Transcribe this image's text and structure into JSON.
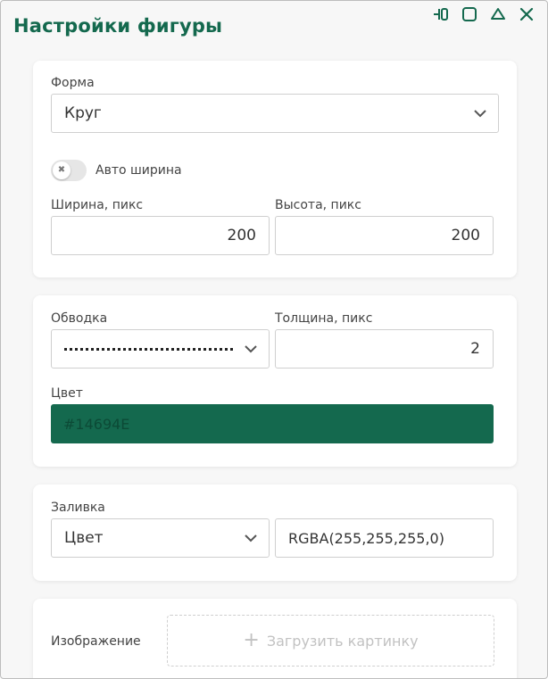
{
  "window": {
    "title": "Настройки фигуры"
  },
  "shape": {
    "label": "Форма",
    "value": "Круг",
    "auto_width_label": "Авто ширина",
    "auto_width_on": false,
    "width_label": "Ширина, пикс",
    "width_value": "200",
    "height_label": "Высота, пикс",
    "height_value": "200"
  },
  "stroke": {
    "label": "Обводка",
    "thickness_label": "Толщина, пикс",
    "thickness_value": "2",
    "color_label": "Цвет",
    "color_value": "#14694E"
  },
  "fill": {
    "label": "Заливка",
    "type_value": "Цвет",
    "color_value": "RGBA(255,255,255,0)"
  },
  "image": {
    "label": "Изображение",
    "upload_label": "Загрузить картинку"
  },
  "colors": {
    "accent": "#14694E"
  },
  "icons": [
    "pin-icon",
    "maximize-icon",
    "collapse-icon",
    "close-icon",
    "chevron-down-icon",
    "plus-icon",
    "x-icon"
  ]
}
